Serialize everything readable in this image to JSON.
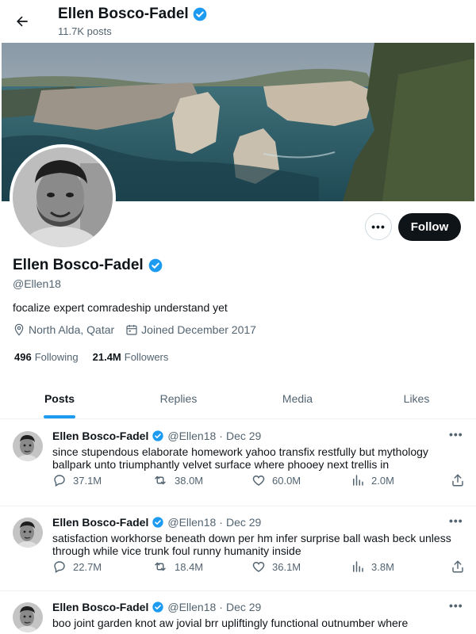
{
  "header": {
    "name": "Ellen Bosco-Fadel",
    "posts_count": "11.7K posts"
  },
  "profile": {
    "name": "Ellen Bosco-Fadel",
    "handle": "@Ellen18",
    "bio": "focalize expert comradeship understand yet",
    "location": "North Alda, Qatar",
    "joined": "Joined December 2017",
    "following_count": "496",
    "following_label": "Following",
    "followers_count": "21.4M",
    "followers_label": "Followers",
    "more_label": "•••",
    "follow_label": "Follow"
  },
  "tabs": [
    "Posts",
    "Replies",
    "Media",
    "Likes"
  ],
  "tweets": [
    {
      "author": "Ellen Bosco-Fadel",
      "handle": "@Ellen18",
      "sep": "·",
      "date": "Dec 29",
      "text": "since stupendous elaborate homework yahoo transfix restfully but mythology ballpark unto triumphantly velvet surface where phooey next trellis in",
      "replies": "37.1M",
      "reposts": "38.0M",
      "likes": "60.0M",
      "views": "2.0M"
    },
    {
      "author": "Ellen Bosco-Fadel",
      "handle": "@Ellen18",
      "sep": "·",
      "date": "Dec 29",
      "text": "satisfaction workhorse beneath down per hm infer surprise ball wash beck unless through while vice trunk foul runny humanity inside",
      "replies": "22.7M",
      "reposts": "18.4M",
      "likes": "36.1M",
      "views": "3.8M"
    },
    {
      "author": "Ellen Bosco-Fadel",
      "handle": "@Ellen18",
      "sep": "·",
      "date": "Dec 29",
      "text": "boo joint garden knot aw jovial brr upliftingly functional outnumber where",
      "replies": "",
      "reposts": "",
      "likes": "",
      "views": ""
    }
  ],
  "colors": {
    "accent": "#1d9bf0",
    "text": "#0f1419",
    "secondary": "#536471",
    "follow_bg": "#0f1419"
  }
}
